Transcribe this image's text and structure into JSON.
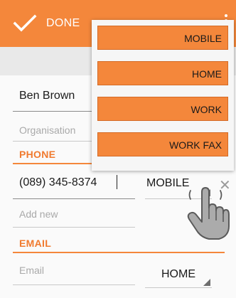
{
  "toolbar": {
    "done_label": "DONE",
    "check_icon": "checkmark-icon",
    "overflow_icon": "more-vert-icon"
  },
  "contact": {
    "name": "Ben Brown",
    "organisation_placeholder": "Organisation"
  },
  "phone": {
    "section_label": "PHONE",
    "number": "(089) 345-8374",
    "type": "MOBILE",
    "add_new_placeholder": "Add new"
  },
  "email": {
    "section_label": "EMAIL",
    "placeholder": "Email",
    "type": "HOME"
  },
  "type_menu": {
    "items": [
      {
        "label": "MOBILE"
      },
      {
        "label": "HOME"
      },
      {
        "label": "WORK"
      },
      {
        "label": "WORK FAX"
      }
    ]
  },
  "colors": {
    "accent": "#f4873b",
    "accent_text": "#f07a2e"
  }
}
